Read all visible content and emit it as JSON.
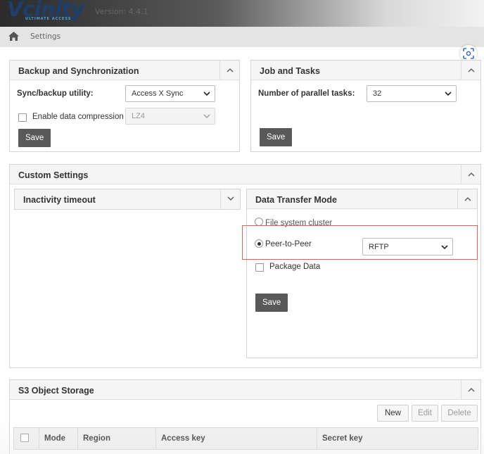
{
  "app": {
    "logo_text": "Vcinity",
    "logo_tagline": "ULTIMATE ACCESS",
    "version": "Version: 4.4.1"
  },
  "breadcrumb": {
    "home_icon": "home-icon",
    "current": "Settings"
  },
  "backup_panel": {
    "title": "Backup and Synchronization",
    "sync_label": "Sync/backup utility:",
    "sync_value": "Access X Sync",
    "compression_label": "Enable data compression",
    "compression_checked": false,
    "compression_value": "LZ4",
    "save": "Save"
  },
  "jobs_panel": {
    "title": "Job and Tasks",
    "parallel_label": "Number of parallel tasks:",
    "parallel_value": "32",
    "save": "Save"
  },
  "custom_panel": {
    "title": "Custom Settings",
    "inactivity": {
      "title": "Inactivity timeout"
    },
    "transfer": {
      "title": "Data Transfer Mode",
      "option_cluster": "File system cluster",
      "option_p2p": "Peer-to-Peer",
      "selected": "Peer-to-Peer",
      "protocol_value": "RFTP",
      "package_label": "Package Data",
      "package_checked": false,
      "save": "Save"
    }
  },
  "s3_panel": {
    "title": "S3 Object Storage",
    "buttons": {
      "new": "New",
      "edit": "Edit",
      "delete": "Delete"
    },
    "columns": [
      "Mode",
      "Region",
      "Access key",
      "Secret key"
    ]
  },
  "colors": {
    "highlight": "#e35d5d",
    "button_dark": "#595959",
    "logo": "#1c3f6e"
  }
}
